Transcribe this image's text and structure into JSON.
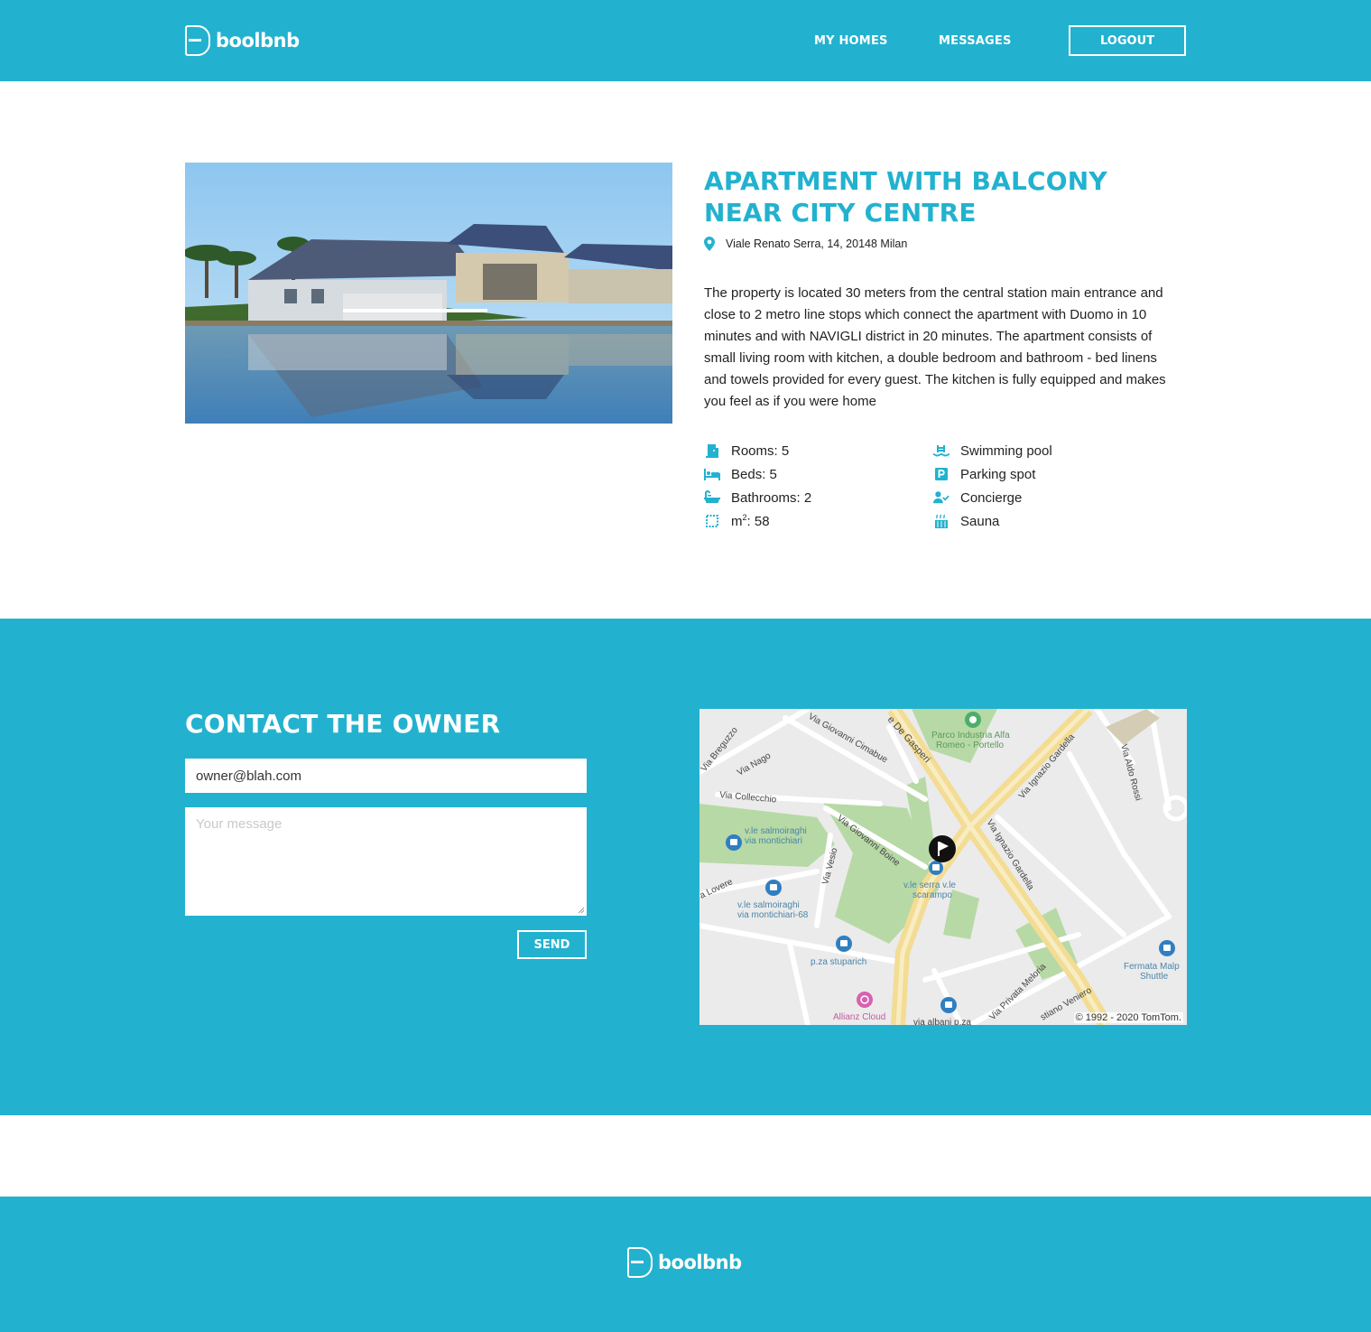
{
  "brand": {
    "name": "boolbnb",
    "logo_icon": "b-logo-icon",
    "color": "#22b2cf"
  },
  "nav": {
    "my_homes": "MY HOMES",
    "messages": "MESSAGES",
    "logout": "LOGOUT"
  },
  "listing": {
    "title": "APARTMENT WITH BALCONY NEAR CITY CENTRE",
    "address": "Viale Renato Serra, 14, 20148 Milan",
    "description": "The property is located 30 meters from the central station main entrance and close to 2 metro line stops which connect the apartment with Duomo in 10 minutes and with NAVIGLI district in 20 minutes. The apartment consists of small living room with kitchen, a double bedroom and bathroom - bed linens and towels provided for every guest. The kitchen is fully equipped and makes you feel as if you were home",
    "specs": {
      "rooms": "Rooms: 5",
      "beds": "Beds: 5",
      "bathrooms": "Bathrooms: 2",
      "area_prefix": "m",
      "area_sup": "2",
      "area_value": ": 58"
    },
    "services": {
      "pool": "Swimming pool",
      "parking": "Parking spot",
      "concierge": "Concierge",
      "sauna": "Sauna"
    }
  },
  "contact": {
    "title": "CONTACT THE OWNER",
    "email_value": "owner@blah.com",
    "message_placeholder": "Your message",
    "send": "SEND"
  },
  "map": {
    "copyright": "© 1992 - 2020 TomTom.",
    "labels": {
      "park": "Parco Industria Alfa\nRomeo - Portello",
      "gasperi": "e De Gasperi",
      "cimabue": "Via Giovanni Cimabue",
      "breguzzo": "Via Breguzzo",
      "nago": "Via Nago",
      "collecchio": "Via Collecchio",
      "boine": "Via Giovanni Boine",
      "vesio": "Via Vesio",
      "lovere": "a Lovere",
      "gardella1": "Via Ignazio Gardella",
      "gardella2": "Via Ignazio Gardella",
      "aldo_rossi": "Via Aldo Rossi",
      "salmoiraghi1": "v.le salmoiraghi\nvia montichiari",
      "salmoiraghi2": "v.le salmoiraghi\nvia montichiari-68",
      "serra": "v.le serra v.le\nscarampo",
      "stuparich": "p.za stuparich",
      "allianz": "Allianz Cloud",
      "albani": "via albani p.za",
      "meloria": "Via Privata Meloria",
      "veniero": "stiano Veniero",
      "fermata": "Fermata Malp\nShuttle"
    }
  }
}
